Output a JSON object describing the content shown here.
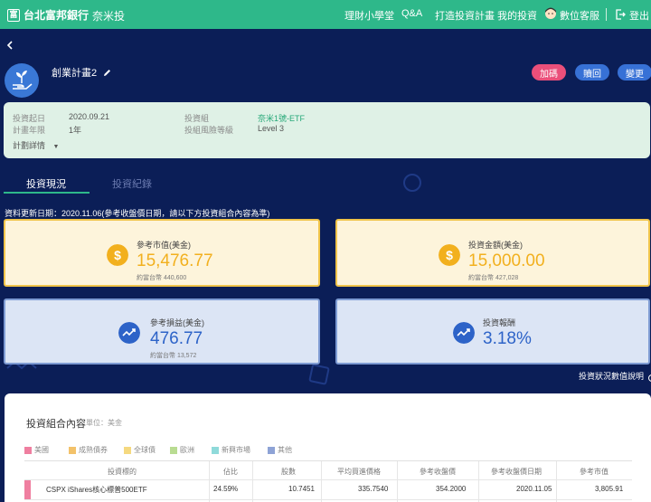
{
  "header": {
    "brand": "台北富邦銀行",
    "product": "奈米投",
    "nav": [
      "理財小學堂",
      "Q&A",
      "打造投資計畫",
      "我的投資",
      "數位客服",
      "登出"
    ]
  },
  "plan": {
    "name": "創業計畫2",
    "buttons": {
      "add": "加碼",
      "redeem": "贖回",
      "change": "變更"
    },
    "info": {
      "start_label": "投資起日",
      "start_value": "2020.09.21",
      "term_label": "計畫年限",
      "term_value": "1年",
      "fund_label": "投資組",
      "fund_value": "奈米1號-ETF",
      "risk_label": "投組風險等級",
      "risk_value": "Level 3",
      "detail_toggle": "計劃詳情"
    }
  },
  "tabs": [
    "投資現況",
    "投資紀錄"
  ],
  "update_note": "資料更新日期：2020.11.06(參考收盤價日期，請以下方投資組合內容為準)",
  "cards": {
    "market_value": {
      "label": "參考市值(美金)",
      "value": "15,476.77",
      "sub": "約當台幣 440,600"
    },
    "invest_amount": {
      "label": "投資金額(美金)",
      "value": "15,000.00",
      "sub": "約當台幣 427,028"
    },
    "pnl": {
      "label": "參考損益(美金)",
      "value": "476.77",
      "sub": "約當台幣 13,572"
    },
    "return": {
      "label": "投資報酬",
      "value": "3.18%"
    }
  },
  "explain_link": "投資狀況數值說明",
  "portfolio": {
    "title": "投資組合內容",
    "unit": "單位：美金",
    "legend": [
      {
        "name": "美國",
        "color": "#ef7fa0"
      },
      {
        "name": "成熟債券",
        "color": "#f3c26a"
      },
      {
        "name": "全球債",
        "color": "#f5d980"
      },
      {
        "name": "歐洲",
        "color": "#b9dc92"
      },
      {
        "name": "新興市場",
        "color": "#8fdada"
      },
      {
        "name": "其他",
        "color": "#8ea3d6"
      }
    ],
    "columns": [
      "投資標的",
      "佔比",
      "股數",
      "平均買進價格",
      "參考收盤價",
      "參考收盤價日期",
      "參考市值"
    ],
    "rows": [
      {
        "name": "CSPX iShares核心標普500ETF",
        "ratio": "24.59%",
        "shares": "10.7451",
        "avg_price": "335.7540",
        "close": "354.2000",
        "date": "2020.11.05",
        "value": "3,805.91"
      }
    ]
  }
}
